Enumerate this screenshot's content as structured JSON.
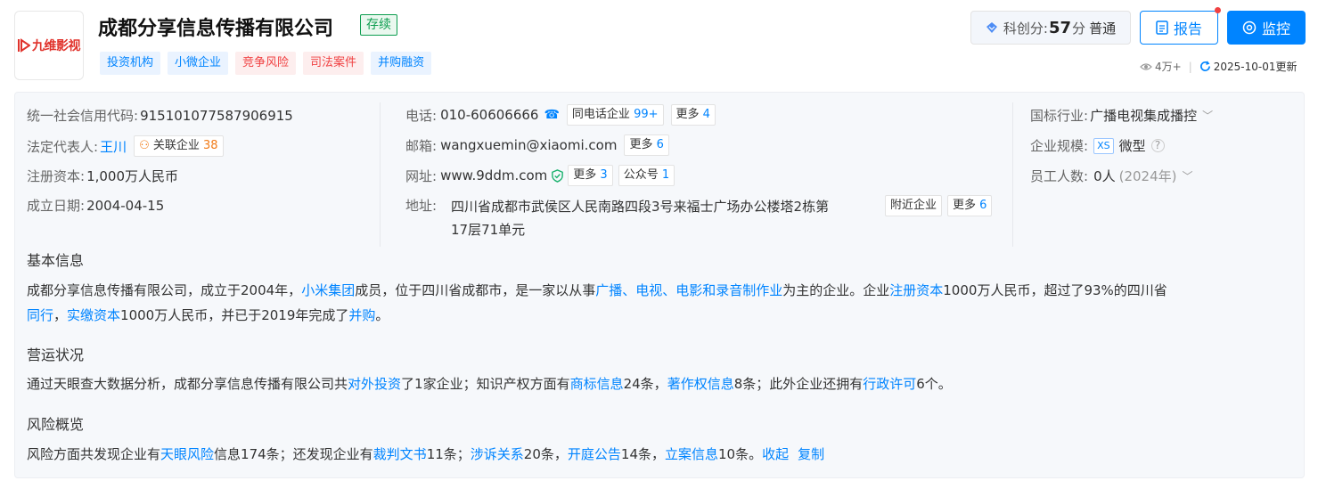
{
  "header": {
    "logo_text": "九维影视",
    "company_name": "成都分享信息传播有限公司",
    "status": "存续",
    "tags": [
      {
        "label": "投资机构",
        "color": "blue"
      },
      {
        "label": "小微企业",
        "color": "blue"
      },
      {
        "label": "竞争风险",
        "color": "red"
      },
      {
        "label": "司法案件",
        "color": "red"
      },
      {
        "label": "并购融资",
        "color": "blue"
      }
    ],
    "score_label": "科创分:",
    "score_value": "57",
    "score_unit": "分",
    "score_level": "普通",
    "report_label": "报告",
    "watch_label": "监控",
    "views": "4万+",
    "updated": "2025-10-01更新"
  },
  "info": {
    "credit_code_label": "统一社会信用代码:",
    "credit_code": "915101077587906915",
    "legal_rep_label": "法定代表人:",
    "legal_rep": "王川",
    "related_label": "关联企业",
    "related_count": "38",
    "capital_label": "注册资本:",
    "capital": "1,000万人民币",
    "founded_label": "成立日期:",
    "founded": "2004-04-15",
    "phone_label": "电话:",
    "phone": "010-60606666",
    "same_phone_label": "同电话企业",
    "same_phone_count": "99+",
    "phone_more_label": "更多",
    "phone_more_count": "4",
    "email_label": "邮箱:",
    "email": "wangxuemin@xiaomi.com",
    "email_more_label": "更多",
    "email_more_count": "6",
    "web_label": "网址:",
    "web": "www.9ddm.com",
    "web_more_label": "更多",
    "web_more_count": "3",
    "wechat_label": "公众号",
    "wechat_count": "1",
    "address_label": "地址:",
    "address_line1": "四川省成都市武侯区人民南路四段3号来福士广场办公楼塔2栋第",
    "address_line2": "17层71单元",
    "nearby_label": "附近企业",
    "addr_more_label": "更多",
    "addr_more_count": "6",
    "industry_label": "国标行业:",
    "industry": "广播电视集成播控",
    "scale_label": "企业规模:",
    "scale_badge": "XS",
    "scale": "微型",
    "staff_label": "员工人数:",
    "staff": "0人",
    "staff_year": "(2024年)"
  },
  "basic": {
    "title": "基本信息",
    "p1_a": "成都分享信息传播有限公司，成立于2004年，",
    "p1_link1": "小米集团",
    "p1_b": "成员，位于四川省成都市，是一家以从事",
    "p1_link2": "广播、电视、电影和录音制作业",
    "p1_c": "为主的企业。企业",
    "p1_link3": "注册资本",
    "p1_d": "1000万人民币，超过了93%的四川省",
    "p2_link1": "同行",
    "p2_a": "，",
    "p2_link2": "实缴资本",
    "p2_b": "1000万人民币，并已于2019年完成了",
    "p2_link3": "并购",
    "p2_c": "。"
  },
  "operation": {
    "title": "营运状况",
    "a": "通过天眼查大数据分析，成都分享信息传播有限公司共",
    "link1": "对外投资",
    "b": "了1家企业；知识产权方面有",
    "link2": "商标信息",
    "c": "24条，",
    "link3": "著作权信息",
    "d": "8条；此外企业还拥有",
    "link4": "行政许可",
    "e": "6个。"
  },
  "risk": {
    "title": "风险概览",
    "a": "风险方面共发现企业有",
    "link1": "天眼风险",
    "b": "信息174条；还发现企业有",
    "link2": "裁判文书",
    "c": "11条；",
    "link3": "涉诉关系",
    "d": "20条，",
    "link4": "开庭公告",
    "e": "14条，",
    "link5": "立案信息",
    "f": "10条。",
    "collapse": "收起",
    "copy": "复制"
  }
}
